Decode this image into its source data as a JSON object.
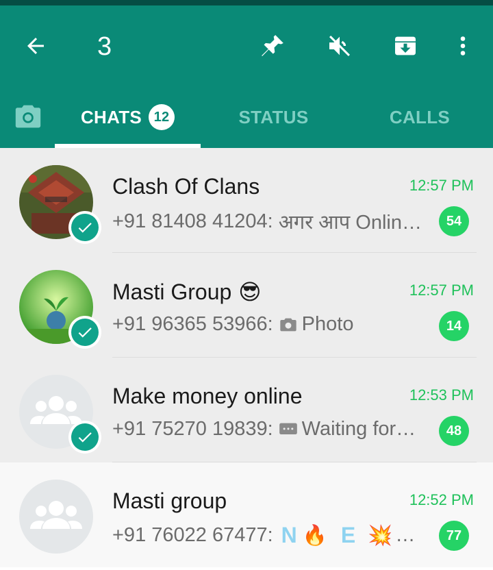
{
  "colors": {
    "primary": "#0a8a77",
    "accent": "#25d366",
    "time": "#1fc15a",
    "tab_inactive": "#7fcfc3"
  },
  "toolbar": {
    "selected_count": "3",
    "icons": [
      "back-arrow-icon",
      "pin-icon",
      "mute-icon",
      "archive-icon",
      "more-vert-icon"
    ]
  },
  "tabs": {
    "chats_label": "CHATS",
    "chats_badge": "12",
    "status_label": "STATUS",
    "calls_label": "CALLS",
    "active": "CHATS"
  },
  "chats": [
    {
      "name": "Clash Of Clans",
      "time": "12:57 PM",
      "sender": "+91 81408 41204:",
      "message": "अगर आप Onlin…",
      "unread": "54",
      "selected": true,
      "name_emoji": ""
    },
    {
      "name": "Masti Group",
      "time": "12:57 PM",
      "sender": "+91 96365 53966:",
      "message": "Photo",
      "message_icon": "camera-icon",
      "unread": "14",
      "selected": true,
      "name_emoji": "😎"
    },
    {
      "name": "Make money online",
      "time": "12:53 PM",
      "sender": "+91 75270 19839:",
      "message": "Waiting for…",
      "message_icon": "message-bubble-icon",
      "unread": "48",
      "selected": true,
      "name_emoji": ""
    },
    {
      "name": "Masti group",
      "time": "12:52 PM",
      "sender": "+91 76022 67477:",
      "message_parts": [
        "N",
        "🔥",
        "E",
        "💥",
        "…"
      ],
      "unread": "77",
      "selected": false,
      "name_emoji": ""
    }
  ]
}
